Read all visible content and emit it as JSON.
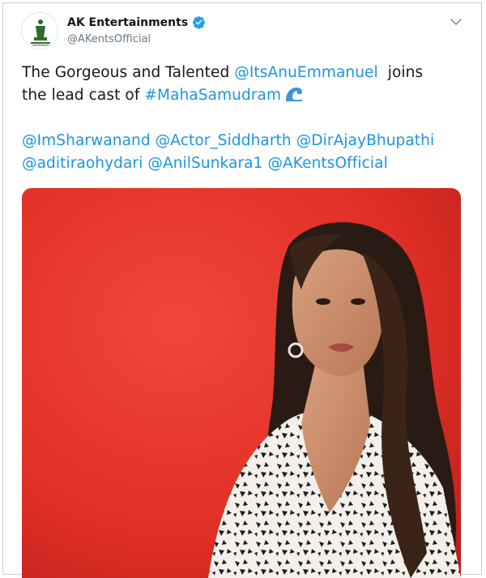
{
  "account": {
    "display_name": "AK Entertainments",
    "handle": "@AKentsOfficial",
    "verified": true
  },
  "tweet": {
    "line1_prefix": "The Gorgeous and Talented ",
    "mention_main": "@ItsAnuEmmanuel",
    "line1_suffix": "  joins",
    "line2_prefix": "the lead cast of ",
    "hashtag": "#MahaSamudram",
    "emoji": "water-wave-emoji",
    "mentions_line3": [
      "@ImSharwanand",
      "@Actor_Siddharth",
      "@DirAjayBhupathi"
    ],
    "mentions_line4": [
      "@aditiraohydari",
      "@AnilSunkara1",
      "@AKentsOfficial"
    ]
  },
  "colors": {
    "link": "#1b95e0",
    "verified": "#1da1f2",
    "media_background": "#e8322a"
  },
  "icons": {
    "verified": "verified-badge-icon",
    "menu": "chevron-down-icon"
  }
}
